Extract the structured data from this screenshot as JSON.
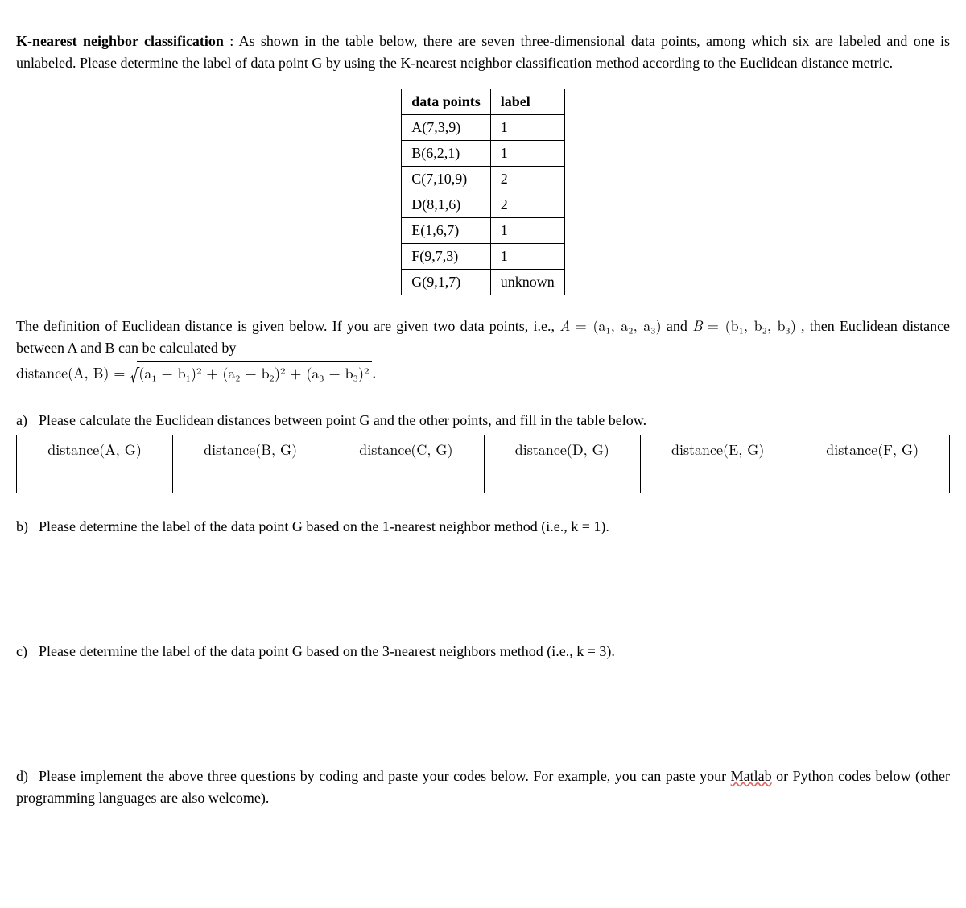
{
  "title": "K-nearest neighbor classification",
  "intro": " : As shown in the table below, there are seven three-dimensional data points, among which six are labeled and one is unlabeled. Please determine the label of data point G by using the K-nearest neighbor classification method according to the Euclidean distance metric.",
  "table": {
    "header_points": "data points",
    "header_label": "label",
    "rows": [
      {
        "point": "A(7,3,9)",
        "label": "1"
      },
      {
        "point": "B(6,2,1)",
        "label": "1"
      },
      {
        "point": "C(7,10,9)",
        "label": "2"
      },
      {
        "point": "D(8,1,6)",
        "label": "2"
      },
      {
        "point": "E(1,6,7)",
        "label": "1"
      },
      {
        "point": "F(9,7,3)",
        "label": "1"
      },
      {
        "point": "G(9,1,7)",
        "label": "unknown"
      }
    ]
  },
  "definition": {
    "lead": "The definition of Euclidean distance is given below. If you are given two data points, i.e., ",
    "A": "A",
    "eq": " = ",
    "Atuple": "(a₁, a₂, a₃)",
    "and": " and ",
    "B": "B",
    "Btuple": "(b₁, b₂, b₃)",
    "tail": ",  then Euclidean distance between A and B can be calculated by",
    "dist_label": "distance(A, B) = ",
    "sqrt_inner": "(a₁ − b₁)² + (a₂ − b₂)² + (a₃ − b₃)²",
    "period": "."
  },
  "qa": {
    "marker": "a)",
    "text": "Please calculate the Euclidean distances between point G and the other points, and fill in the table below.",
    "headers": [
      "distance(A, G)",
      "distance(B, G)",
      "distance(C, G)",
      "distance(D, G)",
      "distance(E, G)",
      "distance(F, G)"
    ]
  },
  "qb": {
    "marker": "b)",
    "text": "Please determine the label of the data point G based on the 1-nearest neighbor method (i.e., k = 1)."
  },
  "qc": {
    "marker": "c)",
    "text": "Please determine the label of the data point G based on the 3-nearest neighbors method (i.e., k = 3)."
  },
  "qd": {
    "marker": "d)",
    "pre": "Please implement the above three questions by coding and paste your codes below. For example, you can paste your ",
    "matlab": "Matlab",
    "post": " or Python codes below (other programming languages are also welcome)."
  }
}
